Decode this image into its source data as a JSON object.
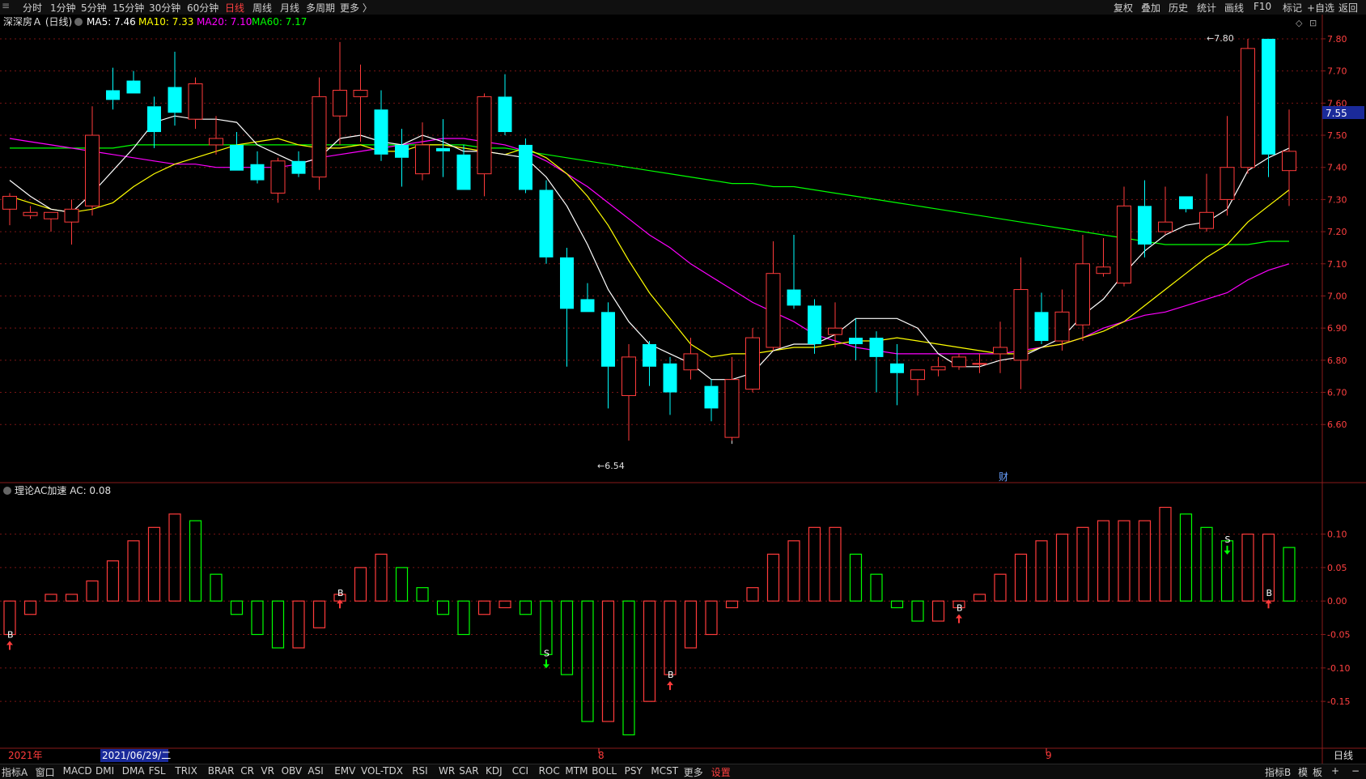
{
  "top_menu": {
    "left": [
      {
        "label": "分时",
        "active": false
      },
      {
        "label": "1分钟",
        "active": false
      },
      {
        "label": "5分钟",
        "active": false
      },
      {
        "label": "15分钟",
        "active": false
      },
      {
        "label": "30分钟",
        "active": false
      },
      {
        "label": "60分钟",
        "active": false
      },
      {
        "label": "日线",
        "active": true
      },
      {
        "label": "周线",
        "active": false
      },
      {
        "label": "月线",
        "active": false
      },
      {
        "label": "多周期",
        "active": false
      },
      {
        "label": "更多 〉",
        "active": false
      }
    ],
    "right": [
      "复权",
      "叠加",
      "历史",
      "统计",
      "画线",
      "F10",
      "标记",
      "+自选",
      "返回"
    ]
  },
  "bottom_tabs": {
    "left": [
      "指标A",
      "窗口",
      "MACD",
      "DMI",
      "DMA",
      "FSL",
      "TRIX",
      "BRAR",
      "CR",
      "VR",
      "OBV",
      "ASI",
      "EMV",
      "VOL-TDX",
      "RSI",
      "WR",
      "SAR",
      "KDJ",
      "CCI",
      "ROC",
      "MTM",
      "BOLL",
      "PSY",
      "MCST",
      "更多",
      "设置"
    ],
    "active": "设置",
    "right": [
      "指标B",
      "模",
      "板",
      "+",
      "−"
    ]
  },
  "colors": {
    "up": "#ff3b3b",
    "down": "#00ffff",
    "ma5": "#ffffff",
    "ma10": "#ffff00",
    "ma20": "#ff00ff",
    "ma60": "#00ff00",
    "grid": "#7a1515",
    "ac_up": "#ff3b3b",
    "ac_down": "#00ff00",
    "label_bg": "#1a2a9a"
  },
  "main_header": {
    "stock": "深深房Ａ (日线)",
    "ma5_label": "MA5: 7.46",
    "ma10_label": "MA10: 7.33",
    "ma20_label": "MA20: 7.10",
    "ma60_label": "MA60: 7.17"
  },
  "ac_header": {
    "label": "理论AC加速  AC: 0.08"
  },
  "x_axis": {
    "year_label": "2021年",
    "selected_date": "2021/06/29/二",
    "month_labels": [
      "8",
      "9"
    ],
    "period": "日线"
  },
  "annotations": {
    "low_label": "←6.54",
    "high_label": "←7.80",
    "current_price": "7.55",
    "fin_marker": "财"
  },
  "chart_data": [
    {
      "type": "candlestick",
      "title": "深深房Ａ (日线)",
      "ylim": [
        6.52,
        7.82
      ],
      "yticks": [
        "7.80",
        "7.70",
        "7.60",
        "7.50",
        "7.40",
        "7.30",
        "7.20",
        "7.10",
        "7.00",
        "6.90",
        "6.80",
        "6.70",
        "6.60"
      ],
      "candles": [
        [
          7.27,
          7.32,
          7.22,
          7.31
        ],
        [
          7.25,
          7.28,
          7.24,
          7.26
        ],
        [
          7.24,
          7.26,
          7.2,
          7.26
        ],
        [
          7.23,
          7.3,
          7.16,
          7.27
        ],
        [
          7.28,
          7.59,
          7.25,
          7.5
        ],
        [
          7.64,
          7.71,
          7.58,
          7.61
        ],
        [
          7.67,
          7.7,
          7.63,
          7.63
        ],
        [
          7.59,
          7.62,
          7.46,
          7.51
        ],
        [
          7.65,
          7.76,
          7.53,
          7.57
        ],
        [
          7.55,
          7.68,
          7.52,
          7.66
        ],
        [
          7.47,
          7.56,
          7.44,
          7.49
        ],
        [
          7.47,
          7.51,
          7.39,
          7.39
        ],
        [
          7.41,
          7.45,
          7.35,
          7.36
        ],
        [
          7.32,
          7.43,
          7.29,
          7.42
        ],
        [
          7.42,
          7.45,
          7.37,
          7.38
        ],
        [
          7.37,
          7.68,
          7.33,
          7.62
        ],
        [
          7.56,
          7.79,
          7.47,
          7.64
        ],
        [
          7.62,
          7.72,
          7.48,
          7.64
        ],
        [
          7.58,
          7.64,
          7.42,
          7.44
        ],
        [
          7.47,
          7.52,
          7.34,
          7.43
        ],
        [
          7.38,
          7.54,
          7.36,
          7.47
        ],
        [
          7.46,
          7.55,
          7.37,
          7.45
        ],
        [
          7.44,
          7.47,
          7.33,
          7.33
        ],
        [
          7.38,
          7.63,
          7.31,
          7.62
        ],
        [
          7.62,
          7.69,
          7.5,
          7.51
        ],
        [
          7.47,
          7.49,
          7.32,
          7.33
        ],
        [
          7.33,
          7.36,
          7.1,
          7.12
        ],
        [
          7.12,
          7.15,
          6.78,
          6.96
        ],
        [
          6.99,
          7.04,
          6.95,
          6.95
        ],
        [
          6.95,
          6.98,
          6.65,
          6.78
        ],
        [
          6.69,
          6.85,
          6.55,
          6.81
        ],
        [
          6.85,
          6.86,
          6.72,
          6.78
        ],
        [
          6.79,
          6.81,
          6.63,
          6.7
        ],
        [
          6.77,
          6.87,
          6.74,
          6.82
        ],
        [
          6.72,
          6.74,
          6.61,
          6.65
        ],
        [
          6.56,
          6.81,
          6.55,
          6.74
        ],
        [
          6.71,
          6.9,
          6.7,
          6.87
        ],
        [
          6.84,
          7.17,
          6.83,
          7.07
        ],
        [
          7.02,
          7.19,
          6.96,
          6.97
        ],
        [
          6.97,
          6.99,
          6.82,
          6.85
        ],
        [
          6.88,
          6.98,
          6.84,
          6.9
        ],
        [
          6.87,
          6.93,
          6.8,
          6.85
        ],
        [
          6.87,
          6.89,
          6.7,
          6.81
        ],
        [
          6.79,
          6.85,
          6.66,
          6.76
        ],
        [
          6.74,
          6.77,
          6.69,
          6.77
        ],
        [
          6.77,
          6.81,
          6.75,
          6.78
        ],
        [
          6.78,
          6.82,
          6.77,
          6.81
        ],
        [
          6.79,
          6.82,
          6.76,
          6.79
        ],
        [
          6.82,
          6.92,
          6.76,
          6.84
        ],
        [
          6.8,
          7.12,
          6.71,
          7.02
        ],
        [
          6.95,
          7.01,
          6.85,
          6.86
        ],
        [
          6.86,
          7.02,
          6.83,
          6.95
        ],
        [
          6.91,
          7.19,
          6.86,
          7.1
        ],
        [
          7.07,
          7.18,
          7.06,
          7.09
        ],
        [
          7.04,
          7.34,
          7.03,
          7.28
        ],
        [
          7.28,
          7.36,
          7.12,
          7.16
        ],
        [
          7.2,
          7.34,
          7.19,
          7.23
        ],
        [
          7.31,
          7.31,
          7.26,
          7.27
        ],
        [
          7.21,
          7.38,
          7.2,
          7.26
        ],
        [
          7.3,
          7.56,
          7.25,
          7.4
        ],
        [
          7.4,
          7.8,
          7.38,
          7.77
        ],
        [
          7.8,
          7.8,
          7.37,
          7.44
        ],
        [
          7.39,
          7.58,
          7.28,
          7.45
        ]
      ],
      "ma": {
        "ma5": [
          7.36,
          7.31,
          7.27,
          7.26,
          7.32,
          7.39,
          7.46,
          7.54,
          7.56,
          7.55,
          7.55,
          7.54,
          7.47,
          7.44,
          7.41,
          7.43,
          7.49,
          7.5,
          7.48,
          7.47,
          7.5,
          7.48,
          7.45,
          7.45,
          7.44,
          7.43,
          7.37,
          7.28,
          7.16,
          7.02,
          6.92,
          6.85,
          6.82,
          6.79,
          6.74,
          6.74,
          6.76,
          6.83,
          6.85,
          6.85,
          6.88,
          6.93,
          6.93,
          6.93,
          6.9,
          6.82,
          6.78,
          6.78,
          6.8,
          6.81,
          6.84,
          6.87,
          6.94,
          6.99,
          7.07,
          7.14,
          7.19,
          7.22,
          7.23,
          7.27,
          7.39,
          7.43,
          7.46
        ],
        "ma10": [
          7.31,
          7.29,
          7.27,
          7.26,
          7.27,
          7.29,
          7.34,
          7.38,
          7.41,
          7.43,
          7.45,
          7.47,
          7.48,
          7.49,
          7.47,
          7.46,
          7.46,
          7.47,
          7.45,
          7.45,
          7.47,
          7.47,
          7.46,
          7.45,
          7.44,
          7.46,
          7.43,
          7.38,
          7.31,
          7.22,
          7.11,
          7.01,
          6.93,
          6.85,
          6.81,
          6.82,
          6.82,
          6.83,
          6.84,
          6.84,
          6.85,
          6.86,
          6.86,
          6.87,
          6.86,
          6.85,
          6.84,
          6.83,
          6.82,
          6.82,
          6.84,
          6.85,
          6.87,
          6.89,
          6.92,
          6.97,
          7.02,
          7.07,
          7.12,
          7.16,
          7.23,
          7.28,
          7.33
        ],
        "ma20": [
          7.49,
          7.48,
          7.47,
          7.46,
          7.45,
          7.44,
          7.43,
          7.42,
          7.41,
          7.41,
          7.4,
          7.4,
          7.4,
          7.4,
          7.41,
          7.43,
          7.44,
          7.45,
          7.46,
          7.47,
          7.48,
          7.49,
          7.49,
          7.48,
          7.47,
          7.45,
          7.42,
          7.38,
          7.34,
          7.29,
          7.24,
          7.19,
          7.15,
          7.1,
          7.06,
          7.02,
          6.98,
          6.95,
          6.92,
          6.88,
          6.86,
          6.84,
          6.83,
          6.82,
          6.82,
          6.82,
          6.82,
          6.82,
          6.82,
          6.83,
          6.84,
          6.85,
          6.87,
          6.9,
          6.92,
          6.94,
          6.95,
          6.97,
          6.99,
          7.01,
          7.05,
          7.08,
          7.1
        ],
        "ma60": [
          7.46,
          7.46,
          7.46,
          7.46,
          7.46,
          7.46,
          7.47,
          7.47,
          7.47,
          7.47,
          7.47,
          7.47,
          7.47,
          7.47,
          7.47,
          7.47,
          7.47,
          7.47,
          7.47,
          7.47,
          7.47,
          7.47,
          7.47,
          7.46,
          7.46,
          7.45,
          7.44,
          7.43,
          7.42,
          7.41,
          7.4,
          7.39,
          7.38,
          7.37,
          7.36,
          7.35,
          7.35,
          7.34,
          7.34,
          7.33,
          7.32,
          7.31,
          7.3,
          7.29,
          7.28,
          7.27,
          7.26,
          7.25,
          7.24,
          7.23,
          7.22,
          7.21,
          7.2,
          7.19,
          7.18,
          7.17,
          7.16,
          7.16,
          7.16,
          7.16,
          7.16,
          7.17,
          7.17
        ]
      }
    },
    {
      "type": "bar",
      "title": "理论AC加速",
      "ylim": [
        -0.22,
        0.16
      ],
      "yticks": [
        "0.10",
        "0.05",
        "0.00",
        "-0.05",
        "-0.10",
        "-0.15"
      ],
      "values": [
        -0.05,
        -0.02,
        0.01,
        0.01,
        0.03,
        0.06,
        0.09,
        0.11,
        0.13,
        0.12,
        0.04,
        -0.02,
        -0.05,
        -0.07,
        -0.07,
        -0.04,
        0.01,
        0.05,
        0.07,
        0.05,
        0.02,
        -0.02,
        -0.05,
        -0.02,
        -0.01,
        -0.02,
        -0.08,
        -0.11,
        -0.18,
        -0.18,
        -0.2,
        -0.15,
        -0.11,
        -0.07,
        -0.05,
        -0.01,
        0.02,
        0.07,
        0.09,
        0.11,
        0.11,
        0.07,
        0.04,
        -0.01,
        -0.03,
        -0.03,
        -0.01,
        0.01,
        0.04,
        0.07,
        0.09,
        0.1,
        0.11,
        0.12,
        0.12,
        0.12,
        0.14,
        0.13,
        0.11,
        0.09,
        0.1,
        0.1,
        0.08
      ],
      "signals": [
        {
          "index": 0,
          "label": "B"
        },
        {
          "index": 16,
          "label": "B"
        },
        {
          "index": 26,
          "label": "S"
        },
        {
          "index": 32,
          "label": "B"
        },
        {
          "index": 46,
          "label": "B"
        },
        {
          "index": 59,
          "label": "S"
        },
        {
          "index": 61,
          "label": "B"
        }
      ]
    }
  ]
}
